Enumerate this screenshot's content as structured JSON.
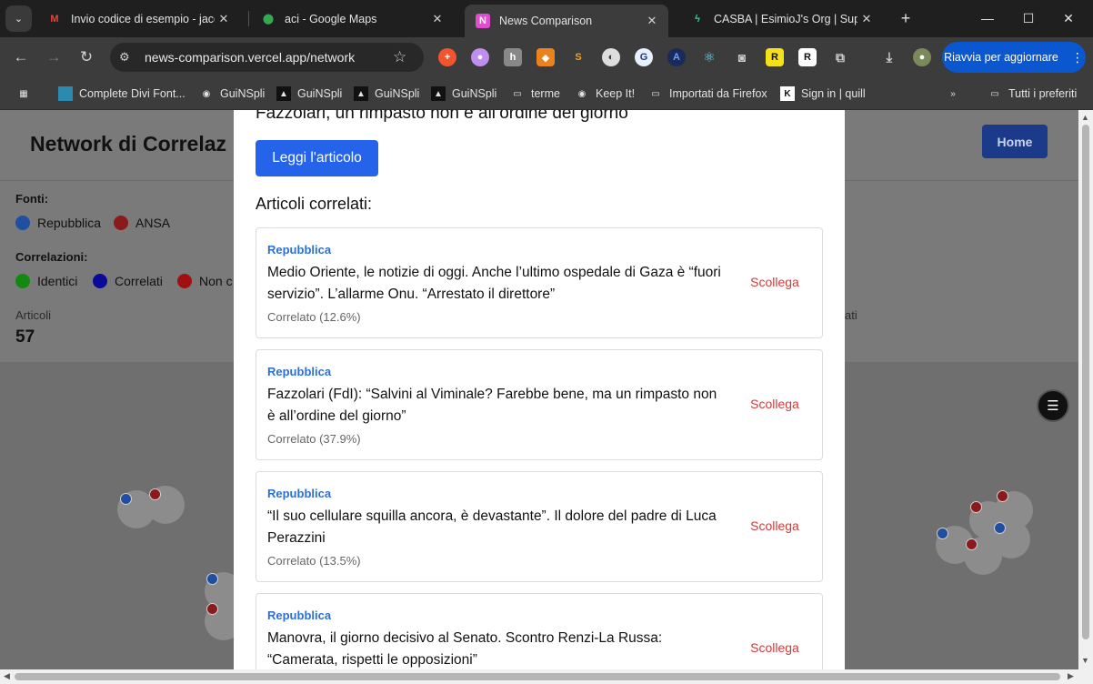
{
  "browser": {
    "tabs": [
      {
        "title": "Invio codice di esempio - jacop",
        "favicon": "gmail-icon",
        "active": false
      },
      {
        "title": "aci - Google Maps",
        "favicon": "maps-icon",
        "active": false
      },
      {
        "title": "News Comparison",
        "favicon": "app-icon",
        "active": true
      },
      {
        "title": "CASBA | EsimioJ's Org | Supaba",
        "favicon": "supabase-icon",
        "active": false
      }
    ],
    "url": "news-comparison.vercel.app/network",
    "update_button": "Riavvia per aggiornare",
    "bookmarks": [
      {
        "label": "Complete Divi Font..."
      },
      {
        "label": "GuiNSpli"
      },
      {
        "label": "GuiNSpli"
      },
      {
        "label": "GuiNSpli"
      },
      {
        "label": "GuiNSpli"
      },
      {
        "label": "terme"
      },
      {
        "label": "Keep It!"
      },
      {
        "label": "Importati da Firefox"
      },
      {
        "label": "Sign in | quill"
      }
    ],
    "all_bookmarks": "Tutti i preferiti"
  },
  "page": {
    "title": "Network di Correlaz",
    "home_button": "Home",
    "sources_label": "Fonti:",
    "sources": [
      {
        "name": "Repubblica",
        "color": "#1f4fa0"
      },
      {
        "name": "ANSA",
        "color": "#8b1a1a"
      }
    ],
    "correlations_label": "Correlazioni:",
    "correlations": [
      {
        "name": "Identici",
        "color": "#128a12"
      },
      {
        "name": "Correlati",
        "color": "#0a0a9a"
      },
      {
        "name": "Non c",
        "color": "#a01010"
      }
    ],
    "articles_label": "Articoli",
    "articles_count": "57",
    "right_stat_fragment": "ati"
  },
  "modal": {
    "heading": "Fazzolari, un rimpasto non è all’ordine del giorno",
    "read_button": "Leggi l'articolo",
    "related_title": "Articoli correlati:",
    "unlink_label": "Scollega",
    "related": [
      {
        "source": "Repubblica",
        "title": "Medio Oriente, le notizie di oggi. Anche l’ultimo ospedale di Gaza è “fuori servizio”. L’allarme Onu. “Arrestato il direttore”",
        "pct": "Correlato (12.6%)"
      },
      {
        "source": "Repubblica",
        "title": "Fazzolari (FdI): “Salvini al Viminale? Farebbe bene, ma un rimpasto non è all’ordine del giorno”",
        "pct": "Correlato (37.9%)"
      },
      {
        "source": "Repubblica",
        "title": "“Il suo cellulare squilla ancora, è devastante”. Il dolore del padre di Luca Perazzini",
        "pct": "Correlato (13.5%)"
      },
      {
        "source": "Repubblica",
        "title": "Manovra, il giorno decisivo al Senato. Scontro Renzi-La Russa: “Camerata, rispetti le opposizioni”",
        "pct": ""
      }
    ]
  }
}
